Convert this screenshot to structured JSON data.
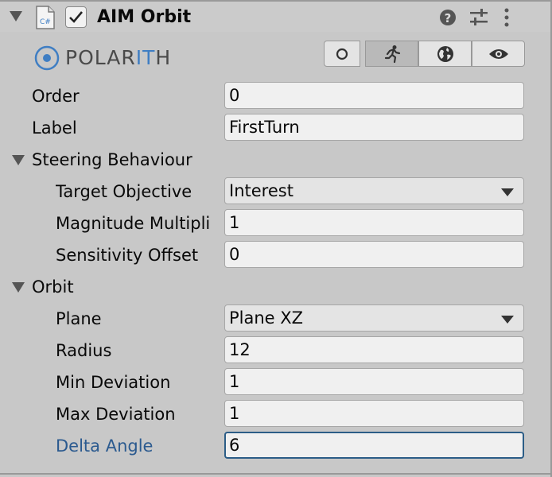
{
  "component": {
    "title": "AIM Orbit",
    "enabled": true,
    "script_icon_text": "C#"
  },
  "logo": {
    "text_a": "POLAR",
    "text_b": "IT",
    "text_c": "H"
  },
  "toolbar": {
    "tabs": [
      {
        "icon": "circle-icon",
        "active": false
      },
      {
        "icon": "running-icon",
        "active": true
      },
      {
        "icon": "globe-icon",
        "active": false
      },
      {
        "icon": "eye-icon",
        "active": false
      }
    ]
  },
  "fields": {
    "order": {
      "label": "Order",
      "value": "0"
    },
    "label": {
      "label": "Label",
      "value": "FirstTurn"
    }
  },
  "steering": {
    "header": "Steering Behaviour",
    "target_objective": {
      "label": "Target Objective",
      "value": "Interest"
    },
    "magnitude_multiplier": {
      "label": "Magnitude Multipli",
      "value": "1"
    },
    "sensitivity_offset": {
      "label": "Sensitivity Offset",
      "value": "0"
    }
  },
  "orbit": {
    "header": "Orbit",
    "plane": {
      "label": "Plane",
      "value": "Plane XZ"
    },
    "radius": {
      "label": "Radius",
      "value": "12"
    },
    "min_deviation": {
      "label": "Min Deviation",
      "value": "1"
    },
    "max_deviation": {
      "label": "Max Deviation",
      "value": "1"
    },
    "delta_angle": {
      "label": "Delta Angle",
      "value": "6"
    }
  },
  "colors": {
    "panel_bg": "#c8c8c8",
    "focus_border": "#2c5d87",
    "label_highlight": "#2b5a8f",
    "logo_accent": "#3f7ec3"
  }
}
